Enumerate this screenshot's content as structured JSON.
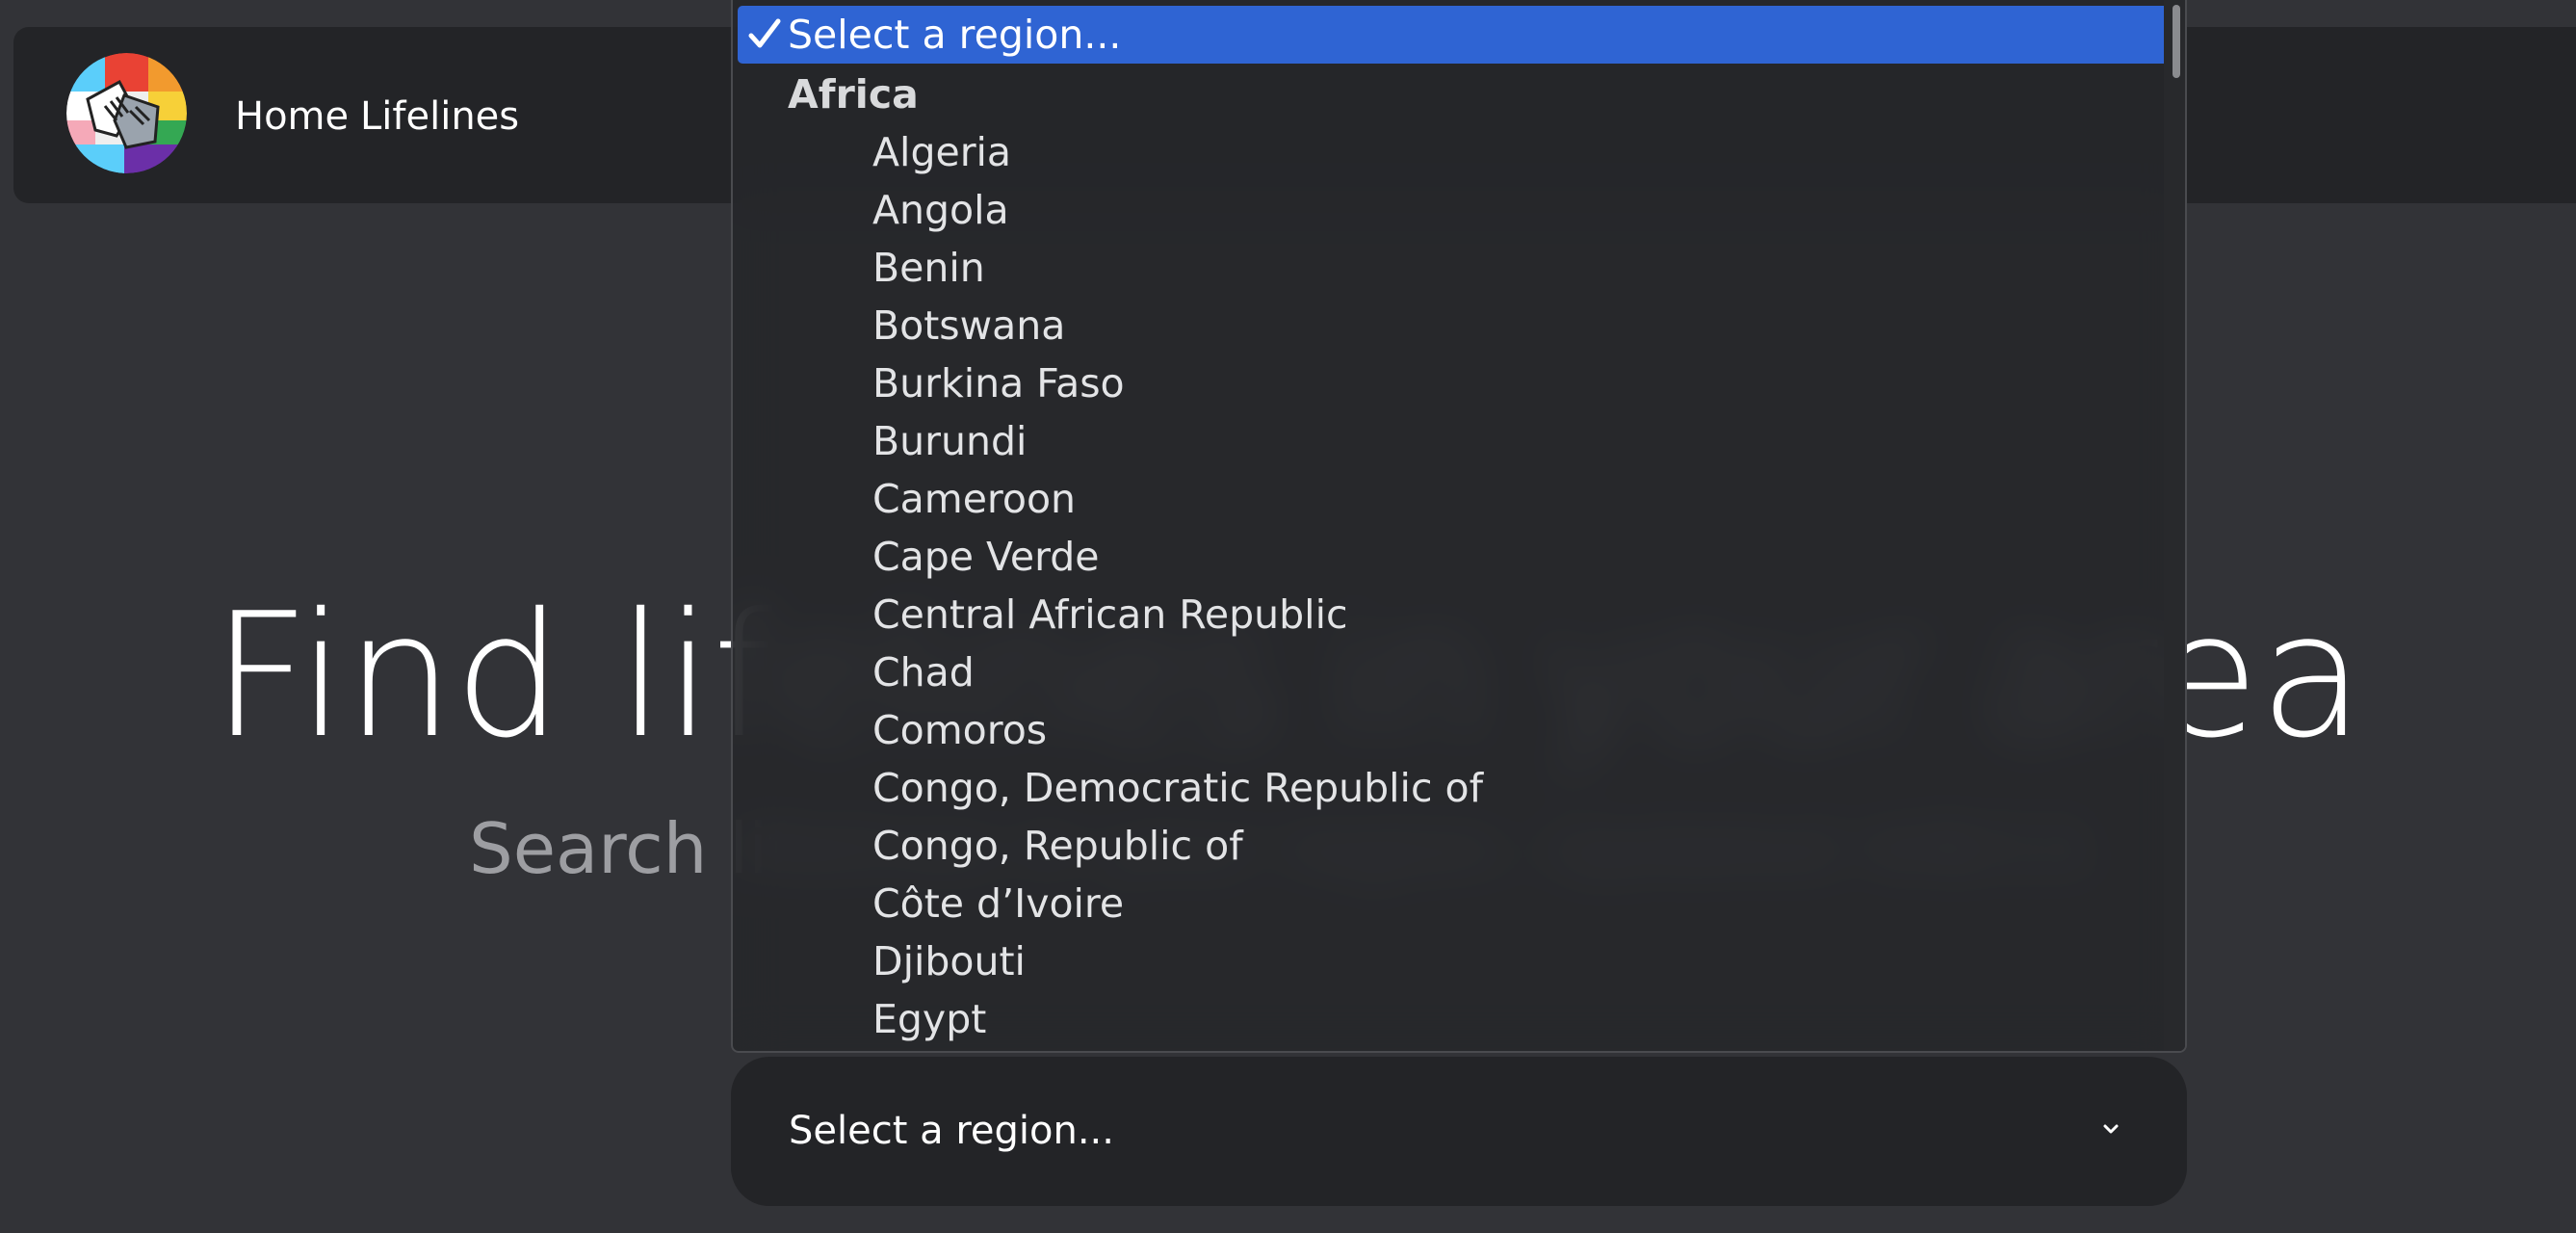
{
  "navbar": {
    "logo_name": "hands-rainbow-logo",
    "links": [
      {
        "label": "Home"
      },
      {
        "label": "Lifelines"
      }
    ]
  },
  "hero": {
    "title": "Find lifelines in your area",
    "subtitle": "Search lifelines in your region. Updated 4/8/13."
  },
  "region_select": {
    "value": "Select a region...",
    "icon": "chevron-down-icon"
  },
  "dropdown": {
    "selected_label": "Select a region...",
    "check_icon": "checkmark-icon",
    "group_label": "Africa",
    "options": [
      "Algeria",
      "Angola",
      "Benin",
      "Botswana",
      "Burkina Faso",
      "Burundi",
      "Cameroon",
      "Cape Verde",
      "Central African Republic",
      "Chad",
      "Comoros",
      "Congo, Democratic Republic of",
      "Congo, Republic of",
      "Côte d’Ivoire",
      "Djibouti",
      "Egypt"
    ]
  },
  "colors": {
    "page_bg": "#323337",
    "navbar_bg": "#232427",
    "highlight": "#2f64d3",
    "accent_button": "#5b5cf0",
    "subtitle_text": "#9d9ea2"
  }
}
